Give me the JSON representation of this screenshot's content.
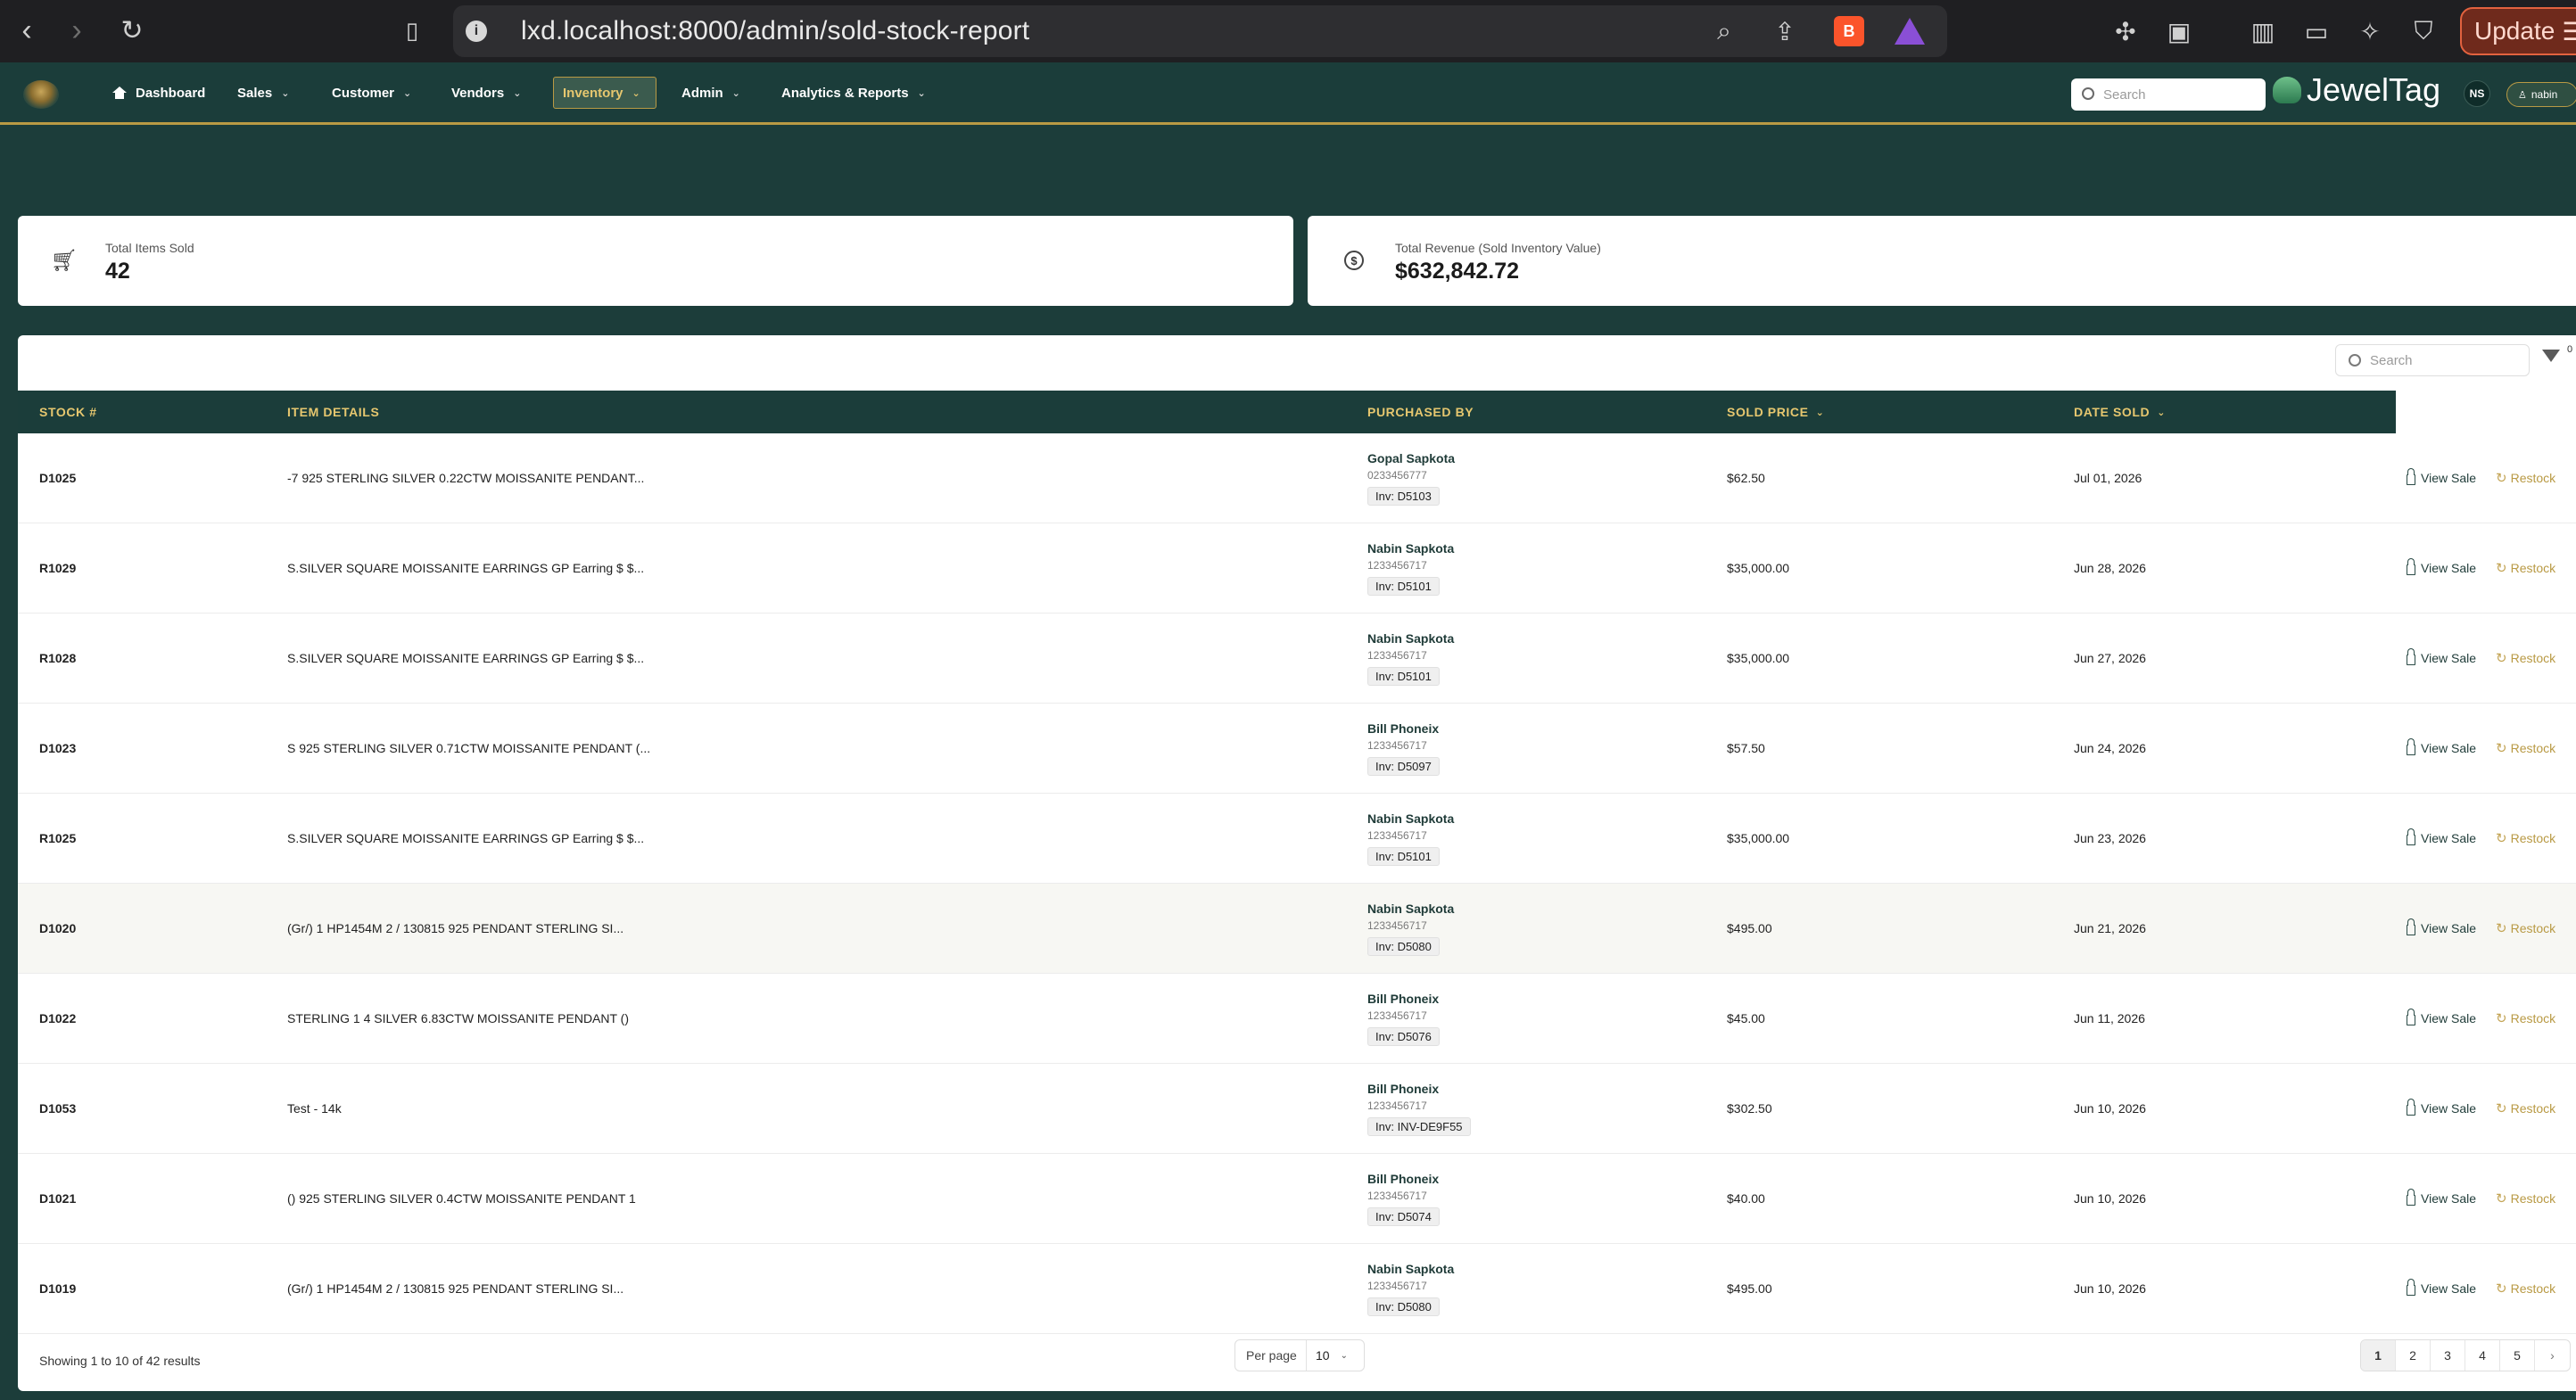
{
  "browser": {
    "url": "lxd.localhost:8000/admin/sold-stock-report",
    "update_label": "Update"
  },
  "header": {
    "nav": [
      {
        "label": "Dashboard"
      },
      {
        "label": "Sales"
      },
      {
        "label": "Customer"
      },
      {
        "label": "Vendors"
      },
      {
        "label": "Inventory"
      },
      {
        "label": "Admin"
      },
      {
        "label": "Analytics & Reports"
      }
    ],
    "search_placeholder": "Search",
    "brand": "JewelTag",
    "avatar_initials": "NS",
    "user": "nabin"
  },
  "stats": {
    "items_sold_label": "Total Items Sold",
    "items_sold_value": "42",
    "revenue_label": "Total Revenue (Sold Inventory Value)",
    "revenue_value": "$632,842.72"
  },
  "table": {
    "search_placeholder": "Search",
    "filter_count": "0",
    "columns": {
      "stock": "STOCK #",
      "item": "ITEM DETAILS",
      "purchased_by": "PURCHASED BY",
      "sold_price": "SOLD PRICE",
      "date_sold": "DATE SOLD"
    },
    "view_label": "View Sale",
    "restock_label": "Restock",
    "rows": [
      {
        "stock": "D1025",
        "item": "-7 925 STERLING SILVER 0.22CTW MOISSANITE PENDANT...",
        "name": "Gopal Sapkota",
        "phone": "0233456777",
        "inv": "Inv: D5103",
        "price": "$62.50",
        "date": "Jul 01, 2026"
      },
      {
        "stock": "R1029",
        "item": "S.SILVER SQUARE MOISSANITE EARRINGS GP Earring $ $...",
        "name": "Nabin Sapkota",
        "phone": "1233456717",
        "inv": "Inv: D5101",
        "price": "$35,000.00",
        "date": "Jun 28, 2026"
      },
      {
        "stock": "R1028",
        "item": "S.SILVER SQUARE MOISSANITE EARRINGS GP Earring $ $...",
        "name": "Nabin Sapkota",
        "phone": "1233456717",
        "inv": "Inv: D5101",
        "price": "$35,000.00",
        "date": "Jun 27, 2026"
      },
      {
        "stock": "D1023",
        "item": "S 925 STERLING SILVER 0.71CTW MOISSANITE PENDANT (...",
        "name": "Bill Phoneix",
        "phone": "1233456717",
        "inv": "Inv: D5097",
        "price": "$57.50",
        "date": "Jun 24, 2026"
      },
      {
        "stock": "R1025",
        "item": "S.SILVER SQUARE MOISSANITE EARRINGS GP Earring $ $...",
        "name": "Nabin Sapkota",
        "phone": "1233456717",
        "inv": "Inv: D5101",
        "price": "$35,000.00",
        "date": "Jun 23, 2026"
      },
      {
        "stock": "D1020",
        "item": "(Gr/) 1 HP1454M 2 / 130815 925 PENDANT STERLING SI...",
        "name": "Nabin Sapkota",
        "phone": "1233456717",
        "inv": "Inv: D5080",
        "price": "$495.00",
        "date": "Jun 21, 2026"
      },
      {
        "stock": "D1022",
        "item": "STERLING 1 4 SILVER 6.83CTW MOISSANITE PENDANT ()",
        "name": "Bill Phoneix",
        "phone": "1233456717",
        "inv": "Inv: D5076",
        "price": "$45.00",
        "date": "Jun 11, 2026"
      },
      {
        "stock": "D1053",
        "item": "Test - 14k",
        "name": "Bill Phoneix",
        "phone": "1233456717",
        "inv": "Inv: INV-DE9F55",
        "price": "$302.50",
        "date": "Jun 10, 2026"
      },
      {
        "stock": "D1021",
        "item": "() 925 STERLING SILVER 0.4CTW MOISSANITE PENDANT 1",
        "name": "Bill Phoneix",
        "phone": "1233456717",
        "inv": "Inv: D5074",
        "price": "$40.00",
        "date": "Jun 10, 2026"
      },
      {
        "stock": "D1019",
        "item": "(Gr/) 1 HP1454M 2 / 130815 925 PENDANT STERLING SI...",
        "name": "Nabin Sapkota",
        "phone": "1233456717",
        "inv": "Inv: D5080",
        "price": "$495.00",
        "date": "Jun 10, 2026"
      }
    ]
  },
  "footer": {
    "showing": "Showing 1 to 10 of 42 results",
    "per_page_label": "Per page",
    "per_page_value": "10",
    "pages": [
      "1",
      "2",
      "3",
      "4",
      "5"
    ],
    "next": "›"
  },
  "colors": {
    "header_bg": "#1b3d3a",
    "accent_gold": "#b99a44",
    "header_text_gold": "#e6c76f"
  }
}
